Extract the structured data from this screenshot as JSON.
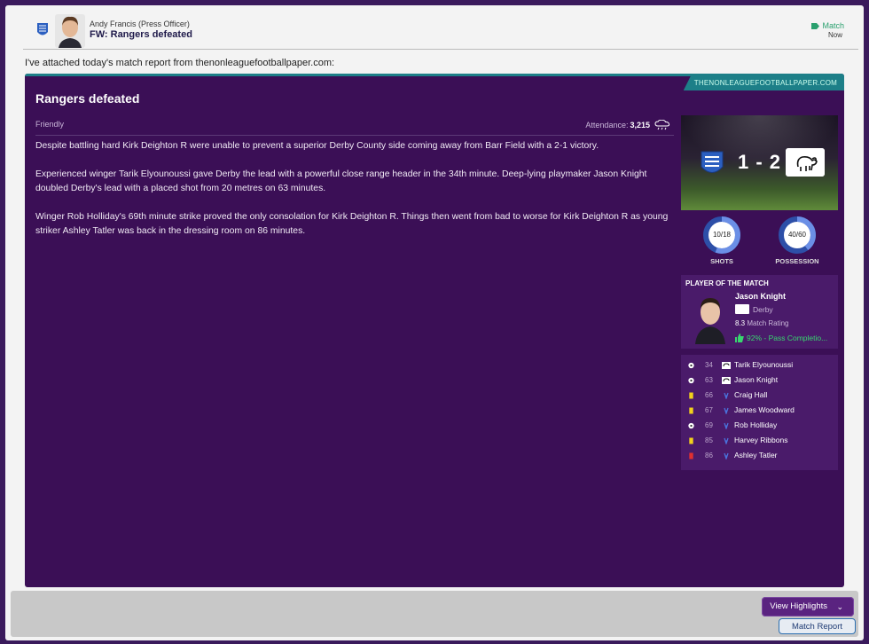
{
  "message": {
    "sender_name": "Andy Francis",
    "sender_role": "(Press Officer)",
    "subject": "FW: Rangers defeated",
    "tag": "Match",
    "time": "Now",
    "intro": "I've attached today's match report from thenonleaguefootballpaper.com:"
  },
  "article": {
    "source": "THENONLEAGUEFOOTBALLPAPER.COM",
    "title": "Rangers defeated",
    "competition": "Friendly",
    "attendance_label": "Attendance:",
    "attendance_value": "3,215",
    "paragraphs": [
      "Despite battling hard Kirk Deighton R were unable to prevent a superior Derby County side coming away from Barr Field with a 2-1 victory.",
      "Experienced winger Tarik Elyounoussi gave Derby the lead with a powerful close range header in the 34th minute. Deep-lying playmaker Jason Knight doubled Derby's lead with a placed shot from 20 metres on 63 minutes.",
      "Winger Rob Holliday's 69th minute strike proved the only consolation for Kirk Deighton R. Things then went from bad to worse for Kirk Deighton R as young striker Ashley Tatler was back in the dressing room on 86 minutes."
    ]
  },
  "score": {
    "text": "1 - 2"
  },
  "stats": [
    {
      "value": "10/18",
      "label": "SHOTS",
      "home_fraction": 0.556
    },
    {
      "value": "40/60",
      "label": "POSSESSION",
      "home_fraction": 0.4
    }
  ],
  "potm": {
    "heading": "PLAYER OF THE MATCH",
    "name": "Jason Knight",
    "club": "Derby",
    "rating_value": "8.3",
    "rating_label": "Match Rating",
    "pass": "92% - Pass Completio..."
  },
  "events": [
    {
      "type": "goal",
      "minute": "34",
      "team": "away",
      "player": "Tarik Elyounoussi"
    },
    {
      "type": "goal",
      "minute": "63",
      "team": "away",
      "player": "Jason Knight"
    },
    {
      "type": "yellow-card",
      "minute": "66",
      "team": "home",
      "player": "Craig Hall"
    },
    {
      "type": "yellow-card",
      "minute": "67",
      "team": "home",
      "player": "James Woodward"
    },
    {
      "type": "goal",
      "minute": "69",
      "team": "home",
      "player": "Rob Holliday"
    },
    {
      "type": "yellow-card",
      "minute": "85",
      "team": "home",
      "player": "Harvey Ribbons"
    },
    {
      "type": "red-card",
      "minute": "86",
      "team": "home",
      "player": "Ashley Tatler"
    }
  ],
  "footer": {
    "highlights_label": "View Highlights",
    "report_label": "Match Report"
  },
  "colors": {
    "panel": "#3b0f56",
    "accent_teal": "#1d7f88",
    "ring_blue": "#3b67d6",
    "positive_green": "#38d66f"
  }
}
